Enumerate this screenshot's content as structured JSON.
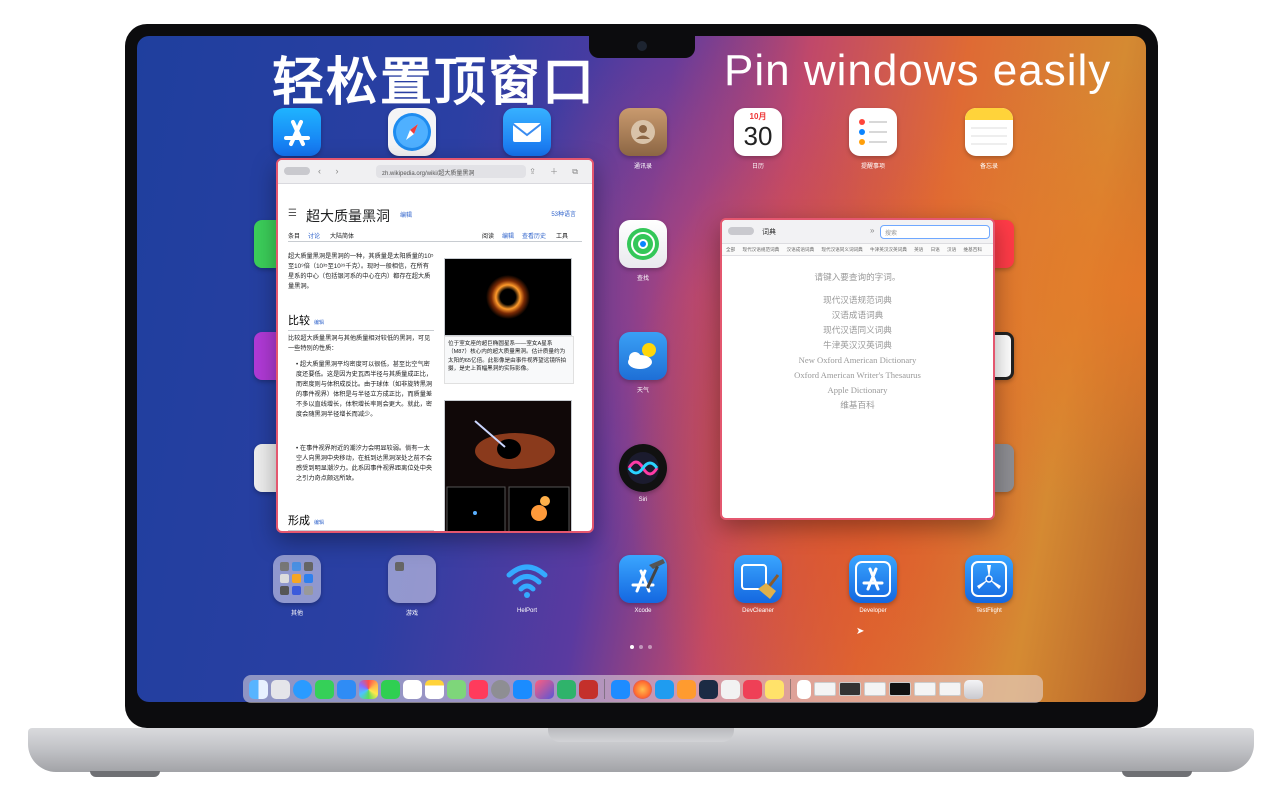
{
  "headline": {
    "zh": "轻松置顶窗口",
    "en": "Pin windows easily"
  },
  "apps": {
    "app_store": "",
    "safari": "",
    "mail": "",
    "contacts": "通讯录",
    "calendar": "日历",
    "calendar_month": "10月",
    "calendar_day": "30",
    "reminders": "提醒事项",
    "notes": "备忘录",
    "find_my": "查找",
    "weather": "天气",
    "siri": "Siri",
    "other_folder": "其他",
    "games_folder": "游戏",
    "hellport": "HelPort",
    "xcode": "Xcode",
    "devcleaner": "DevCleaner",
    "developer": "Developer",
    "testflight": "TestFlight"
  },
  "wiki_window": {
    "url": "zh.wikipedia.org/wiki/超大质量黑洞",
    "title": "超大质量黑洞",
    "edit": "编辑",
    "languages": "53种语言",
    "tabs": {
      "article": "条目",
      "talk": "讨论",
      "variant": "大陆简体",
      "read": "阅读",
      "edit": "编辑",
      "history": "查看历史",
      "tools": "工具"
    },
    "intro": "超大质量黑洞是黑洞的一种，其质量是太阳质量的10⁵至10⁹倍（10³⁵至10³⁹千克）。现时一般相信，在所有星系的中心（包括银河系的中心在内）都存在超大质量黑洞。",
    "section_compare": "比较",
    "section_edit": "编辑",
    "compare_text": "比较超大质量黑洞与其他质量相对较低的黑洞，可见一些特别的性质：",
    "bullet1": "超大质量黑洞平均密度可以很低，甚至比空气密度还要低。这是因为史瓦西半径与其质量成正比，而密度则与体积成反比。由于球体（如非旋转黑洞的事件视界）体积是与半径立方成正比，而质量差不多以直线增长，体积增长率则会更大。就此，密度会随黑洞半径增长而减少。",
    "bullet2": "在事件视界附近的潮汐力会明显较弱。倘有一太空人向黑洞中央移动，在抵到达黑洞深处之前不会感受到明显潮汐力。此系因事件视界距离位处中央之引力奇点颇远所致。",
    "caption": "位于室女座的超巨椭圆星系——室女A星系（M87）核心内的超大质量黑洞。估计质量约为太阳的65亿倍。此影像是由事件视界望远镜所拍摄，是史上首幅黑洞的实际影像。",
    "section_formation": "形成"
  },
  "dict_window": {
    "title": "词典",
    "search_placeholder": "搜索",
    "tabs": [
      "全部",
      "现代汉语规范词典",
      "汉语成语词典",
      "现代汉语同义词词典",
      "牛津英汉汉英词典",
      "英语",
      "日语",
      "汉语",
      "维基百科"
    ],
    "hint": "请键入要查询的字词。",
    "dictionaries": [
      "现代汉语规范词典",
      "汉语成语词典",
      "现代汉语同义词典",
      "牛津英汉汉英词典",
      "New Oxford American Dictionary",
      "Oxford American Writer's Thesaurus",
      "Apple Dictionary",
      "维基百科"
    ]
  },
  "colors": {
    "window_border": "#e4576f",
    "link": "#3366cc"
  }
}
